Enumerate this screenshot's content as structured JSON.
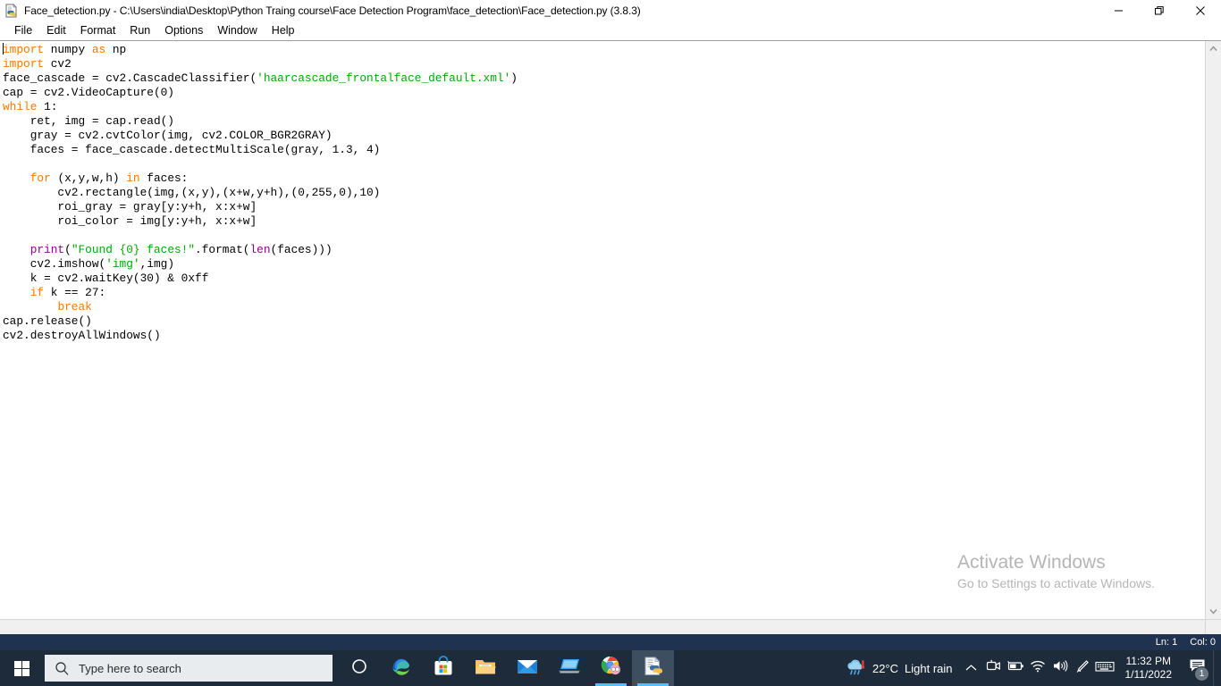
{
  "window": {
    "title": "Face_detection.py - C:\\Users\\india\\Desktop\\Python Traing course\\Face Detection Program\\face_detection\\Face_detection.py (3.8.3)",
    "icon": "python-file-icon",
    "controls": {
      "minimize": "minimize-button",
      "restore": "restore-button",
      "close": "close-button"
    }
  },
  "menubar": {
    "items": [
      {
        "label": "File"
      },
      {
        "label": "Edit"
      },
      {
        "label": "Format"
      },
      {
        "label": "Run"
      },
      {
        "label": "Options"
      },
      {
        "label": "Window"
      },
      {
        "label": "Help"
      }
    ]
  },
  "editor": {
    "language": "python",
    "code_lines": [
      "import numpy as np",
      "import cv2",
      "face_cascade = cv2.CascadeClassifier('haarcascade_frontalface_default.xml')",
      "cap = cv2.VideoCapture(0)",
      "while 1:",
      "    ret, img = cap.read()",
      "    gray = cv2.cvtColor(img, cv2.COLOR_BGR2GRAY)",
      "    faces = face_cascade.detectMultiScale(gray, 1.3, 4)",
      "",
      "    for (x,y,w,h) in faces:",
      "        cv2.rectangle(img,(x,y),(x+w,y+h),(0,255,0),10)",
      "        roi_gray = gray[y:y+h, x:x+w]",
      "        roi_color = img[y:y+h, x:x+w]",
      "",
      "    print(\"Found {0} faces!\".format(len(faces)))",
      "    cv2.imshow('img',img)",
      "    k = cv2.waitKey(30) & 0xff",
      "    if k == 27:",
      "        break",
      "cap.release()",
      "cv2.destroyAllWindows()"
    ],
    "colors": {
      "keyword": "#ff7700",
      "string": "#00aa00",
      "builtin": "#900090",
      "definition": "#0000ff",
      "text": "#000000",
      "background": "#ffffff"
    }
  },
  "statusbar": {
    "line_label": "Ln: 1",
    "column_label": "Col: 0",
    "background": "#1f3250"
  },
  "watermark": {
    "title": "Activate Windows",
    "subtitle": "Go to Settings to activate Windows."
  },
  "taskbar": {
    "background": "#1d2b3a",
    "start": {
      "name": "start-button",
      "icon": "windows-logo-icon"
    },
    "search": {
      "placeholder": "Type here to search",
      "icon": "search-icon"
    },
    "apps": [
      {
        "name": "cortana",
        "icon": "cortana-circle-icon",
        "state": "idle"
      },
      {
        "name": "microsoft-edge",
        "icon": "edge-icon",
        "state": "idle"
      },
      {
        "name": "microsoft-store",
        "icon": "store-icon",
        "state": "idle"
      },
      {
        "name": "file-explorer",
        "icon": "folder-icon",
        "state": "idle"
      },
      {
        "name": "mail",
        "icon": "mail-envelope-icon",
        "state": "idle"
      },
      {
        "name": "remote-desktop",
        "icon": "remote-desktop-icon",
        "state": "idle"
      },
      {
        "name": "google-chrome",
        "icon": "chrome-icon",
        "state": "running"
      },
      {
        "name": "python-idle",
        "icon": "python-file-icon",
        "state": "active"
      }
    ],
    "weather": {
      "icon": "rain-cloud-icon",
      "temperature": "22°C",
      "condition": "Light rain"
    },
    "tray": [
      {
        "name": "show-hidden-icons",
        "icon": "chevron-up-icon"
      },
      {
        "name": "meet-now",
        "icon": "camera-icon"
      },
      {
        "name": "battery",
        "icon": "battery-icon"
      },
      {
        "name": "network",
        "icon": "wifi-icon"
      },
      {
        "name": "volume",
        "icon": "speaker-icon"
      },
      {
        "name": "pen-menu",
        "icon": "pen-icon"
      },
      {
        "name": "touch-keyboard",
        "icon": "keyboard-icon"
      }
    ],
    "clock": {
      "time": "11:32 PM",
      "date": "1/11/2022"
    },
    "notifications": {
      "icon": "action-center-icon",
      "count": "1"
    }
  }
}
